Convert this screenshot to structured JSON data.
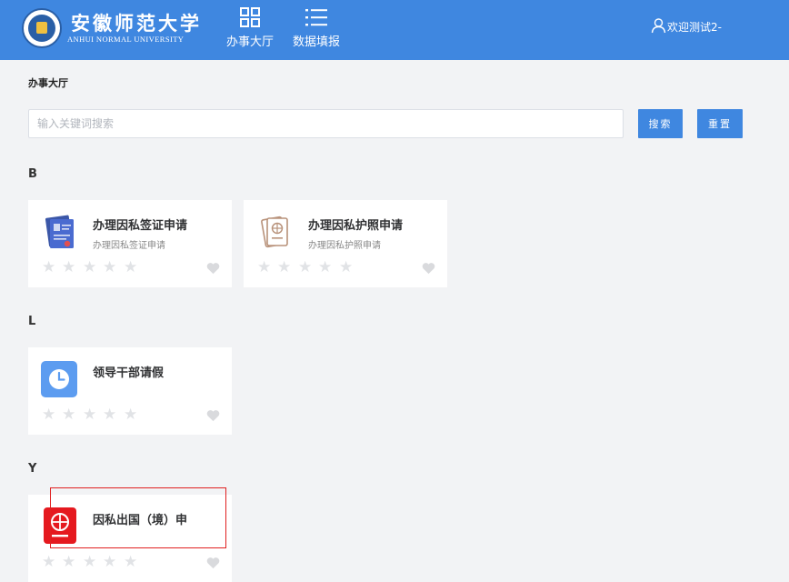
{
  "header": {
    "university_cn": "安徽师范大学",
    "university_en": "ANHUI NORMAL UNIVERSITY",
    "nav": [
      {
        "label": "办事大厅",
        "icon": "grid-icon"
      },
      {
        "label": "数据填报",
        "icon": "list-icon"
      }
    ],
    "user_text": "欢迎测试2-"
  },
  "breadcrumb": "办事大厅",
  "search": {
    "placeholder": "输入关键词搜索",
    "search_label": "搜索",
    "reset_label": "重置"
  },
  "groups": [
    {
      "letter": "B",
      "items": [
        {
          "title": "办理因私签证申请",
          "subtitle": "办理因私签证申请",
          "icon": "visa-document-icon",
          "rating": 0
        },
        {
          "title": "办理因私护照申请",
          "subtitle": "办理因私护照申请",
          "icon": "passport-icon",
          "rating": 0
        }
      ]
    },
    {
      "letter": "L",
      "items": [
        {
          "title": "领导干部请假",
          "subtitle": "",
          "icon": "clock-icon",
          "rating": 0
        }
      ]
    },
    {
      "letter": "Y",
      "items": [
        {
          "title": "因私出国（境）申",
          "subtitle": "",
          "icon": "globe-passport-icon",
          "rating": 0
        }
      ]
    }
  ],
  "colors": {
    "primary": "#3f87e0",
    "background": "#f2f3f5",
    "star_inactive": "#e1e3e6",
    "highlight_border": "#e02020"
  }
}
